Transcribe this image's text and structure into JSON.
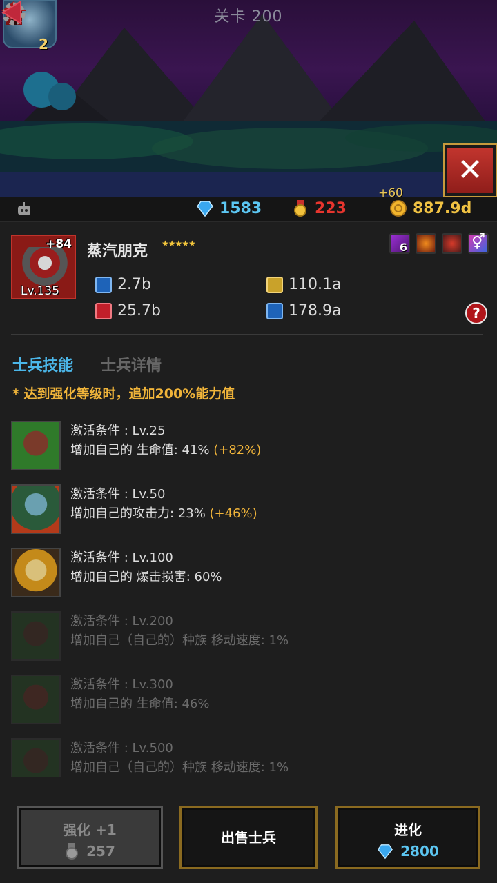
{
  "scene": {
    "stage_label": "关卡 200",
    "hero_count": "2",
    "gold_gain": "+60"
  },
  "currency": {
    "gems": "1583",
    "medals": "223",
    "gold": "887.9d"
  },
  "soldier": {
    "name": "蒸汽朋克",
    "stars": "★★★★★",
    "plus": "+84",
    "level": "Lv.135",
    "rank": "6",
    "stats": {
      "attack": "2.7b",
      "hp": "25.7b",
      "armor": "110.1a",
      "defense": "178.9a"
    }
  },
  "tabs": {
    "skills": "士兵技能",
    "details": "士兵详情"
  },
  "bonus_note": "* 达到强化等级时，追加200%能力值",
  "skills": [
    {
      "cond": "激活条件 : Lv.25",
      "desc": "增加自己的 生命值: 41% ",
      "bonus": "(+82%)"
    },
    {
      "cond": "激活条件 : Lv.50",
      "desc": "增加自己的攻击力: 23% ",
      "bonus": "(+46%)"
    },
    {
      "cond": "激活条件 : Lv.100",
      "desc": "增加自己的 爆击损害: 60%",
      "bonus": ""
    },
    {
      "cond": "激活条件 : Lv.200",
      "desc": "增加自己（自己的）种族 移动速度: 1%",
      "bonus": ""
    },
    {
      "cond": "激活条件 : Lv.300",
      "desc": "增加自己的 生命值: 46%",
      "bonus": ""
    },
    {
      "cond": "激活条件 : Lv.500",
      "desc": "增加自己（自己的）种族 移动速度: 1%",
      "bonus": ""
    }
  ],
  "buttons": {
    "upgrade_label": "强化 +1",
    "upgrade_cost": "257",
    "sell_label": "出售士兵",
    "evolve_label": "进化",
    "evolve_cost": "2800"
  },
  "colors": {
    "gem": "#5cc6f2",
    "medal": "#e7352e",
    "gold": "#f0c243",
    "tab_active": "#4bb6e8",
    "bonus": "#f0b43a"
  }
}
